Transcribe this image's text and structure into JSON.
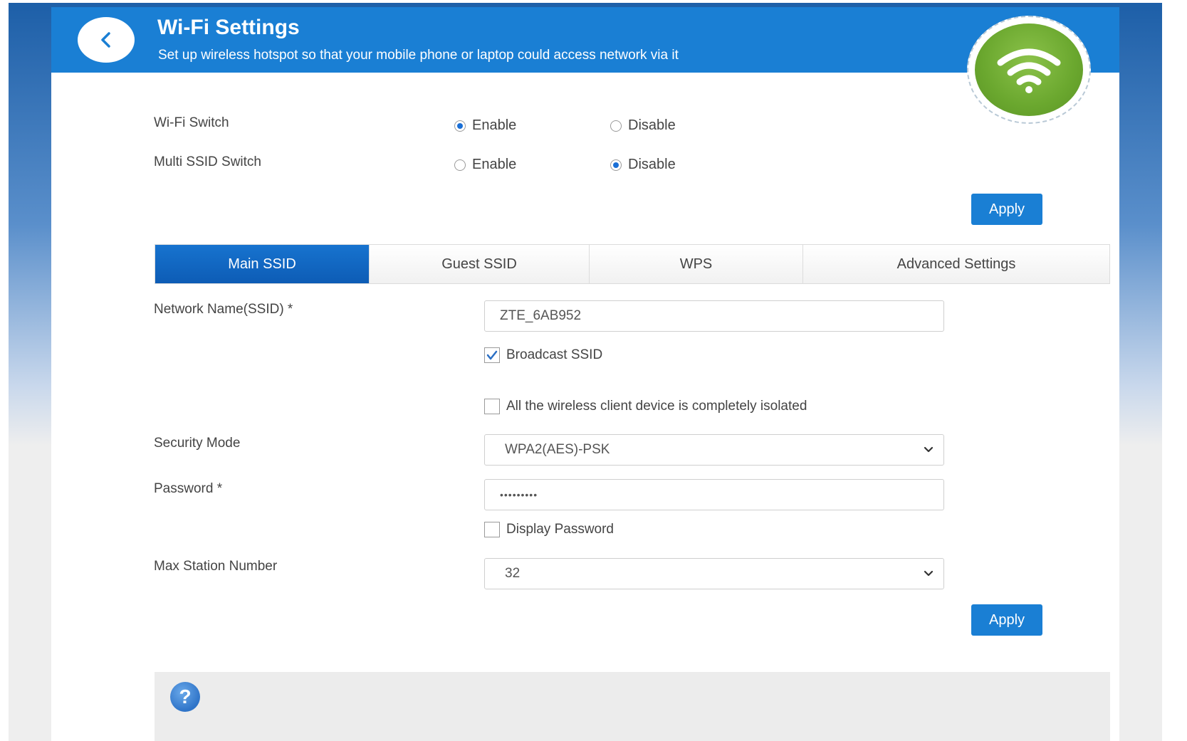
{
  "header": {
    "title": "Wi-Fi Settings",
    "subtitle": "Set up wireless hotspot so that your mobile phone or laptop could access network via it",
    "back_icon": "chevron-left-icon",
    "badge_icon": "wifi-icon"
  },
  "switches": {
    "wifi_switch": {
      "label": "Wi-Fi Switch",
      "enable": "Enable",
      "disable": "Disable",
      "selected": "Enable"
    },
    "multi_ssid_switch": {
      "label": "Multi SSID Switch",
      "enable": "Enable",
      "disable": "Disable",
      "selected": "Disable"
    },
    "apply_label": "Apply"
  },
  "tabs": [
    {
      "label": "Main SSID",
      "active": true
    },
    {
      "label": "Guest SSID",
      "active": false
    },
    {
      "label": "WPS",
      "active": false
    },
    {
      "label": "Advanced Settings",
      "active": false
    }
  ],
  "form": {
    "ssid": {
      "label": "Network Name(SSID) *",
      "value": "ZTE_6AB952"
    },
    "broadcast_ssid": {
      "label": "Broadcast SSID",
      "checked": true
    },
    "isolation": {
      "label": "All the wireless client device is completely isolated",
      "checked": false
    },
    "security_mode": {
      "label": "Security Mode",
      "value": "WPA2(AES)-PSK"
    },
    "password": {
      "label": "Password *",
      "value": "•••••••••"
    },
    "display_password": {
      "label": "Display Password",
      "checked": false
    },
    "max_station": {
      "label": "Max Station Number",
      "value": "32"
    },
    "apply_label": "Apply"
  },
  "help": {
    "icon": "question-icon",
    "glyph": "?"
  },
  "colors": {
    "primary": "#1a7fd4",
    "tab_active": "#0d5cb5",
    "wifi_green": "#6aa72e"
  }
}
